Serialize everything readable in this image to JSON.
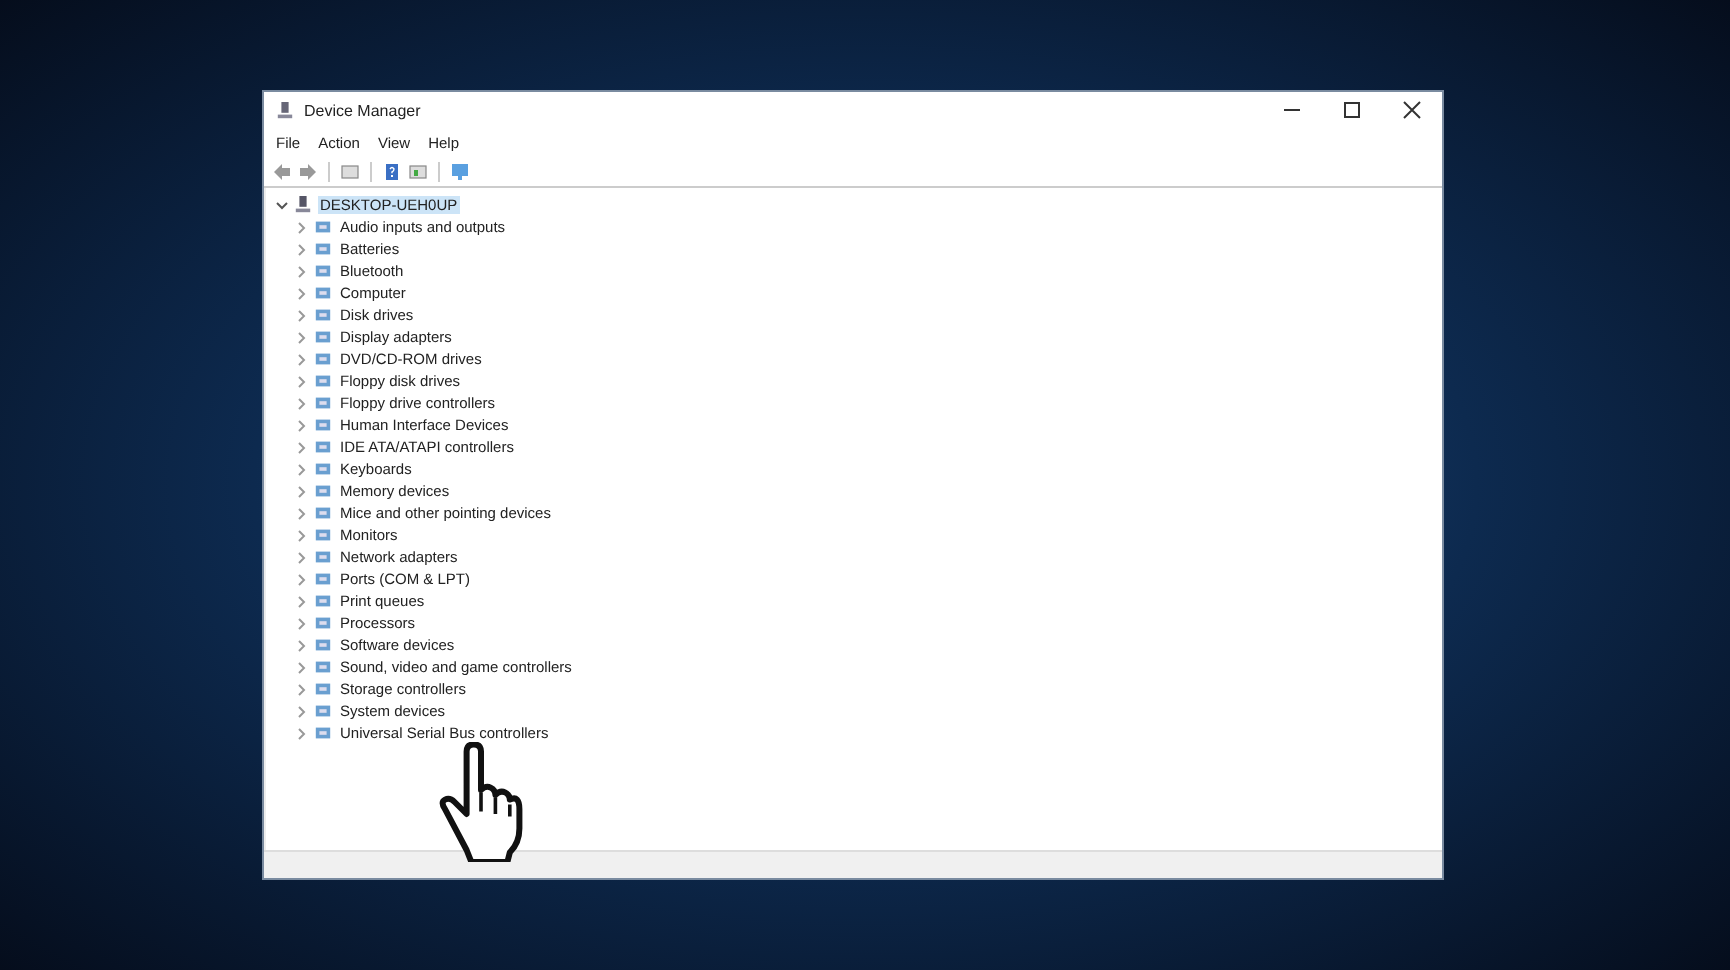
{
  "window": {
    "title": "Device Manager"
  },
  "menu": [
    {
      "label": "File"
    },
    {
      "label": "Action"
    },
    {
      "label": "View"
    },
    {
      "label": "Help"
    }
  ],
  "tree": {
    "label": "DESKTOP-UEH0UP",
    "expanded": true,
    "selected": true,
    "children": [
      {
        "label": "Audio inputs and outputs",
        "expanded": false
      },
      {
        "label": "Batteries",
        "expanded": false
      },
      {
        "label": "Bluetooth",
        "expanded": false
      },
      {
        "label": "Computer",
        "expanded": false
      },
      {
        "label": "Disk drives",
        "expanded": false
      },
      {
        "label": "Display adapters",
        "expanded": false
      },
      {
        "label": "DVD/CD-ROM drives",
        "expanded": false
      },
      {
        "label": "Floppy disk drives",
        "expanded": false
      },
      {
        "label": "Floppy drive controllers",
        "expanded": false
      },
      {
        "label": "Human Interface Devices",
        "expanded": false
      },
      {
        "label": "IDE ATA/ATAPI controllers",
        "expanded": false
      },
      {
        "label": "Keyboards",
        "expanded": false
      },
      {
        "label": "Memory devices",
        "expanded": false
      },
      {
        "label": "Mice and other pointing devices",
        "expanded": false
      },
      {
        "label": "Monitors",
        "expanded": false
      },
      {
        "label": "Network adapters",
        "expanded": false
      },
      {
        "label": "Ports (COM & LPT)",
        "expanded": false
      },
      {
        "label": "Print queues",
        "expanded": false
      },
      {
        "label": "Processors",
        "expanded": false
      },
      {
        "label": "Software devices",
        "expanded": false
      },
      {
        "label": "Sound, video and game controllers",
        "expanded": false
      },
      {
        "label": "Storage controllers",
        "expanded": false
      },
      {
        "label": "System devices",
        "expanded": false
      },
      {
        "label": "Universal Serial Bus controllers",
        "expanded": false
      }
    ]
  }
}
